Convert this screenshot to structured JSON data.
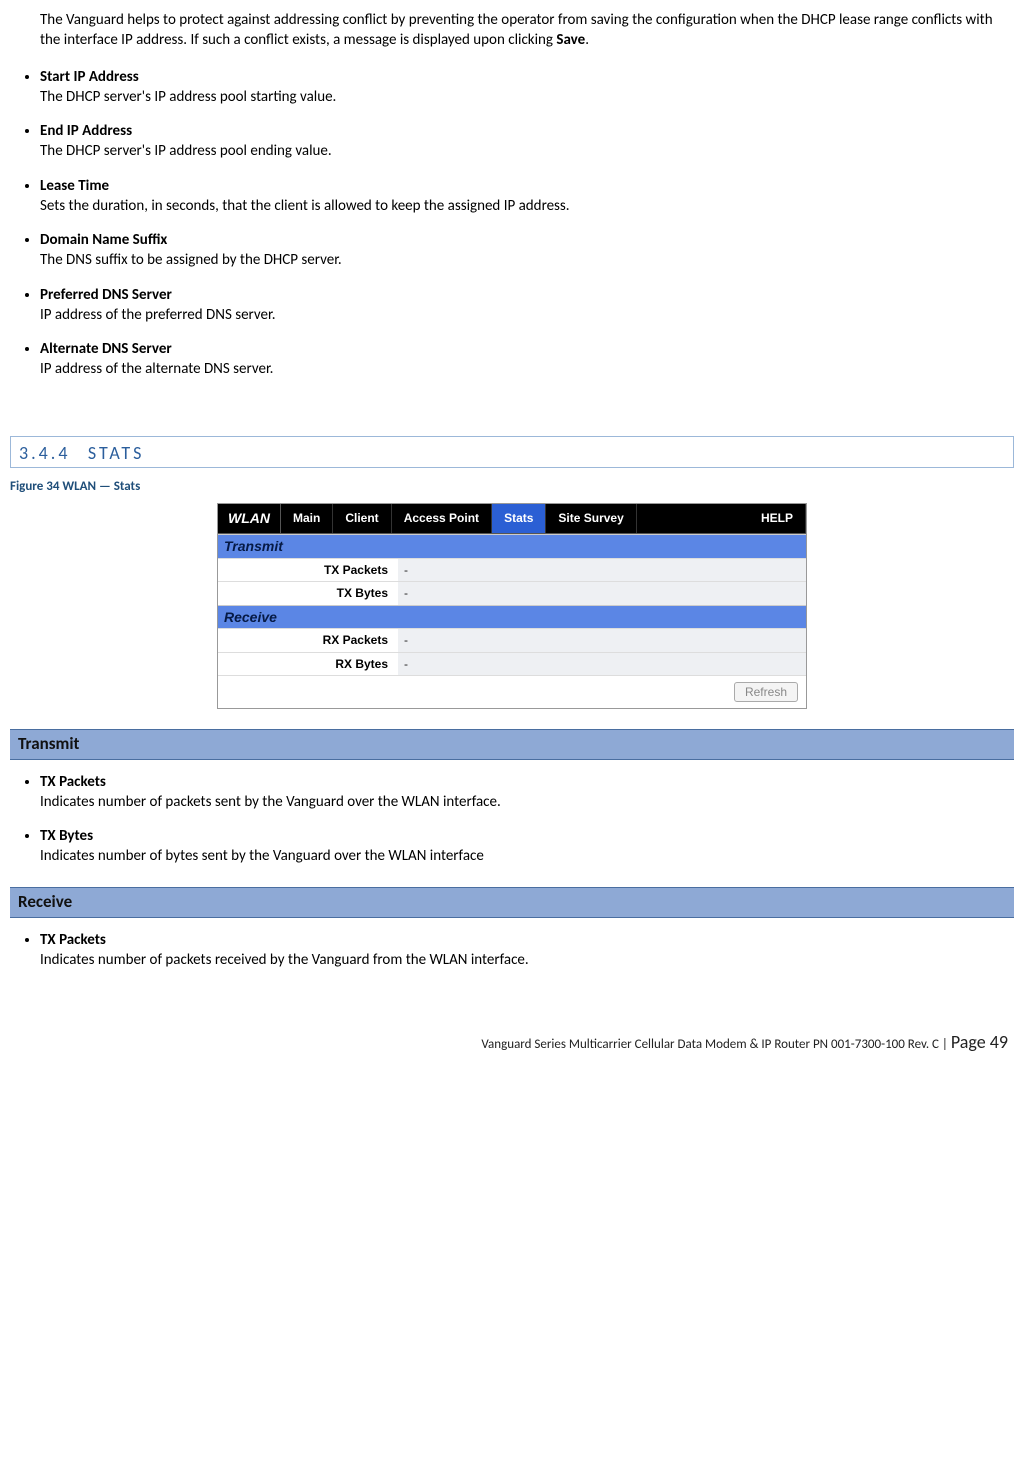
{
  "intro": {
    "part1": "The Vanguard helps to protect against addressing conflict by preventing the operator from saving the configuration when the DHCP lease range conflicts with the interface IP address. If such a conflict exists, a message is displayed upon clicking ",
    "bold": "Save",
    "part2": "."
  },
  "defs1": [
    {
      "term": "Start IP Address",
      "desc": "The DHCP server's IP address pool starting value."
    },
    {
      "term": "End IP Address",
      "desc": "The DHCP server's IP address pool ending value."
    },
    {
      "term": "Lease Time",
      "desc": "Sets the duration, in seconds, that the client is allowed to keep the assigned IP address."
    },
    {
      "term": "Domain Name Suffix",
      "desc": "The DNS suffix to be assigned by the DHCP server."
    },
    {
      "term": "Preferred DNS Server",
      "desc": "IP address of the preferred DNS server."
    },
    {
      "term": "Alternate DNS Server",
      "desc": "IP address of the alternate DNS server."
    }
  ],
  "section": {
    "num": "3.4.4",
    "title": "STATS"
  },
  "caption": "Figure 34 WLAN — Stats",
  "ui": {
    "brand": "WLAN",
    "tabs": [
      "Main",
      "Client",
      "Access Point",
      "Stats",
      "Site Survey"
    ],
    "activeTabIndex": 3,
    "help": "HELP",
    "groups": [
      {
        "name": "Transmit",
        "rows": [
          {
            "label": "TX Packets",
            "value": "-"
          },
          {
            "label": "TX Bytes",
            "value": "-"
          }
        ]
      },
      {
        "name": "Receive",
        "rows": [
          {
            "label": "RX Packets",
            "value": "-"
          },
          {
            "label": "RX Bytes",
            "value": "-"
          }
        ]
      }
    ],
    "refresh": "Refresh"
  },
  "docSubheads": {
    "transmit": "Transmit",
    "receive": "Receive"
  },
  "transmitDefs": [
    {
      "term": "TX Packets",
      "desc": "Indicates number of packets sent by the Vanguard over the WLAN interface."
    },
    {
      "term": "TX Bytes",
      "desc": "Indicates number of bytes sent by the Vanguard over the WLAN interface"
    }
  ],
  "receiveDefs": [
    {
      "term": "TX Packets",
      "desc": "Indicates number of packets received by the Vanguard from the WLAN interface."
    }
  ],
  "footer": {
    "text": "Vanguard Series Multicarrier Cellular Data Modem & IP Router PN 001-7300-100 Rev. C",
    "sep": " | ",
    "pageLabel": "Page 49"
  }
}
